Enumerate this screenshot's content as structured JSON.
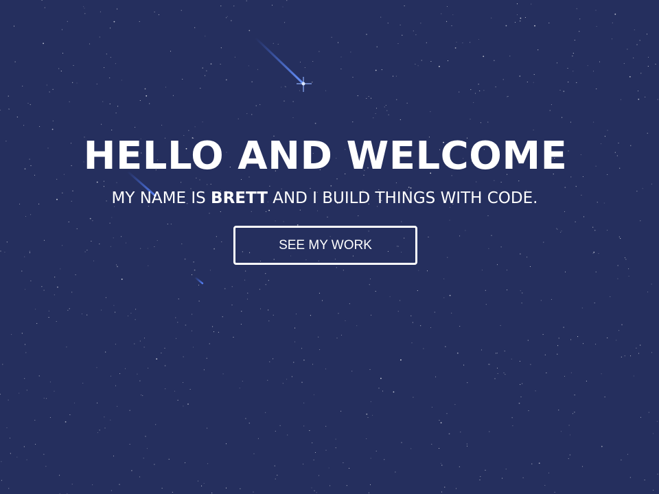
{
  "hero": {
    "title": "HELLO AND WELCOME",
    "subtitle_pre": "MY NAME IS ",
    "subtitle_name": "BRETT",
    "subtitle_post": " AND I BUILD THINGS WITH CODE.",
    "cta_label": "SEE MY WORK"
  },
  "colors": {
    "background": "#252f5e",
    "text": "#ffffff",
    "shooting_star": "#4d7cff"
  }
}
